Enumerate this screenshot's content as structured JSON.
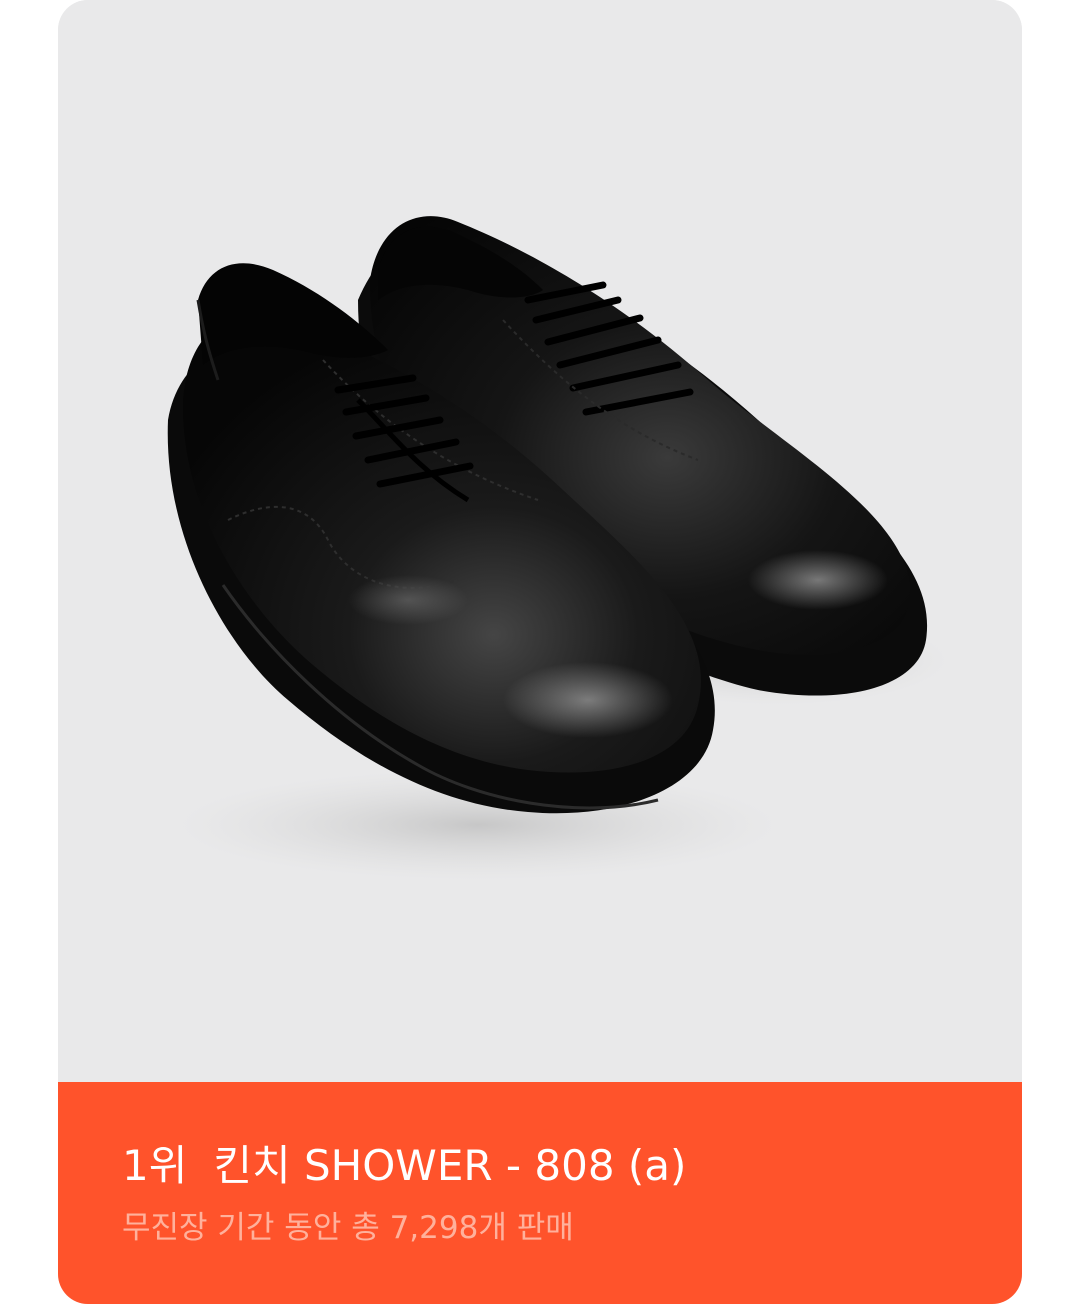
{
  "card": {
    "image": {
      "alt_icon": "black-leather-derby-shoes-image",
      "background_color": "#e9e9ea"
    },
    "banner": {
      "background_color": "#ff532b",
      "rank": "1위",
      "title": "킨치 SHOWER - 808 (a)",
      "subtitle": "무진장 기간 동안 총 7,298개 판매",
      "subtitle_color": "#ffb19c"
    }
  }
}
